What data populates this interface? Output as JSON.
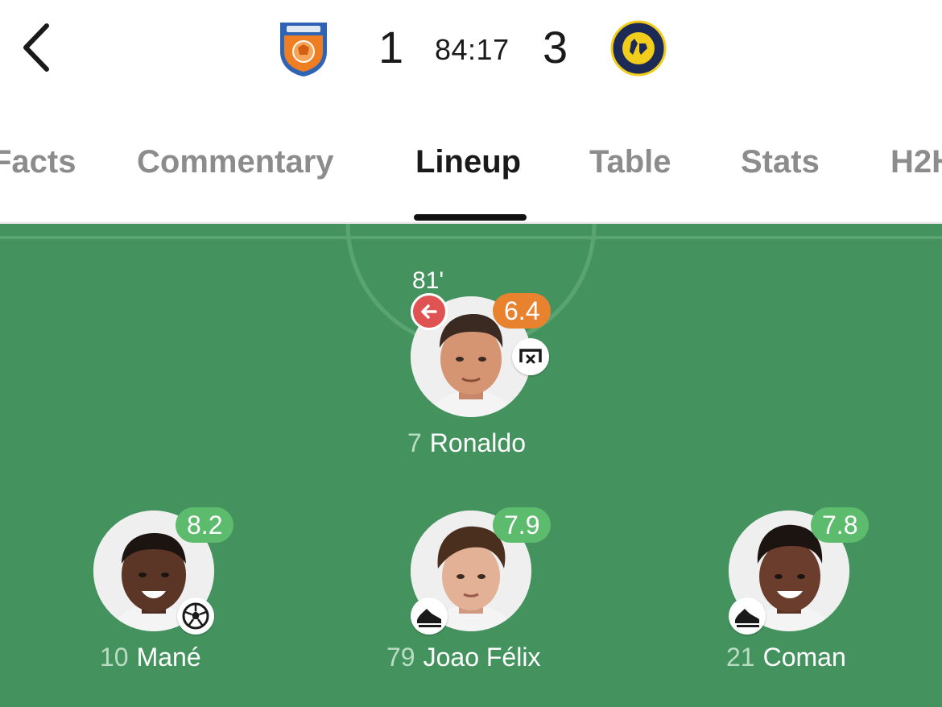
{
  "match": {
    "home_score": "1",
    "away_score": "3",
    "clock": "84:17",
    "home_crest_text": "AL FAYHA CLUB",
    "away_crest_text": "NASSR"
  },
  "tabs": [
    {
      "label": "Facts"
    },
    {
      "label": "Commentary"
    },
    {
      "label": "Lineup",
      "active": true
    },
    {
      "label": "Table"
    },
    {
      "label": "Stats"
    },
    {
      "label": "H2H"
    }
  ],
  "players": [
    {
      "number": "7",
      "name": "Ronaldo",
      "rating": "6.4",
      "rating_color": "#e8822f",
      "sub_minute": "81'",
      "events": [
        "substituted-off-icon",
        "missed-chance-icon"
      ]
    },
    {
      "number": "10",
      "name": "Mané",
      "rating": "8.2",
      "rating_color": "#5dbb6e",
      "events": [
        "goal-icon"
      ]
    },
    {
      "number": "79",
      "name": "Joao Félix",
      "rating": "7.9",
      "rating_color": "#5dbb6e",
      "events": [
        "assist-icon"
      ]
    },
    {
      "number": "21",
      "name": "Coman",
      "rating": "7.8",
      "rating_color": "#5dbb6e",
      "events": [
        "assist-icon"
      ]
    }
  ],
  "colors": {
    "pitch": "#44935f",
    "rating_good": "#5dbb6e",
    "rating_avg": "#e8822f",
    "sub_off": "#df5353"
  }
}
